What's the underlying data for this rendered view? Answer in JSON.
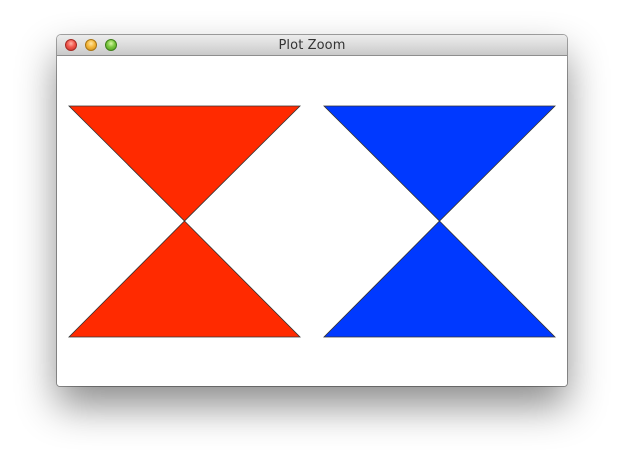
{
  "window": {
    "title": "Plot Zoom"
  },
  "controls": {
    "close": "close-button",
    "minimize": "minimize-button",
    "zoom": "zoom-button"
  },
  "plot": {
    "shapes": [
      {
        "color": "#ff2a00",
        "name": "red-hourglass"
      },
      {
        "color": "#0039ff",
        "name": "blue-hourglass"
      }
    ],
    "outline_color": "#333333"
  }
}
